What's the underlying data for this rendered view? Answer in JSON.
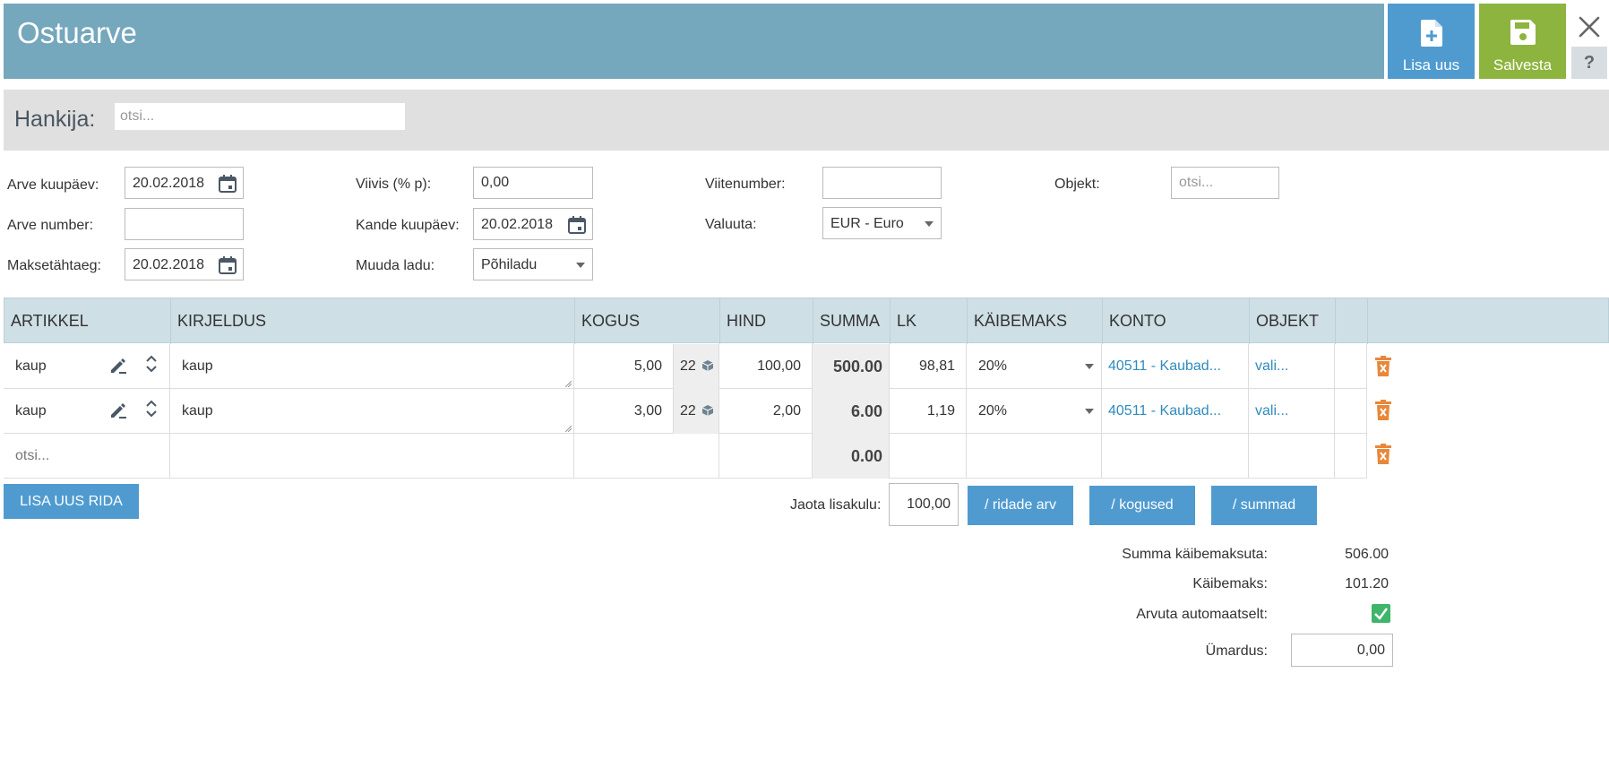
{
  "header": {
    "title": "Ostuarve",
    "add_new_label": "Lisa uus",
    "save_label": "Salvesta",
    "help_label": "?"
  },
  "supplier": {
    "label": "Hankija:",
    "placeholder": "otsi..."
  },
  "form": {
    "invoice_date_label": "Arve kuupäev:",
    "invoice_date": "20.02.2018",
    "invoice_number_label": "Arve number:",
    "invoice_number": "",
    "due_date_label": "Maksetähtaeg:",
    "due_date": "20.02.2018",
    "penalty_label": "Viivis (% p):",
    "penalty": "0,00",
    "entry_date_label": "Kande kuupäev:",
    "entry_date": "20.02.2018",
    "warehouse_label": "Muuda ladu:",
    "warehouse": "Põhiladu",
    "reference_label": "Viitenumber:",
    "reference": "",
    "currency_label": "Valuuta:",
    "currency": "EUR - Euro",
    "object_label": "Objekt:",
    "object_placeholder": "otsi..."
  },
  "table": {
    "columns": [
      "ARTIKKEL",
      "KIRJELDUS",
      "KOGUS",
      "HIND",
      "SUMMA",
      "LK",
      "KÄIBEMAKS",
      "KONTO",
      "OBJEKT"
    ],
    "rows": [
      {
        "article": "kaup",
        "description": "kaup",
        "quantity": "5,00",
        "stock": "22",
        "price": "100,00",
        "sum": "500.00",
        "lk": "98,81",
        "vat": "20%",
        "account": "40511 - Kaubad...",
        "object": "vali..."
      },
      {
        "article": "kaup",
        "description": "kaup",
        "quantity": "3,00",
        "stock": "22",
        "price": "2,00",
        "sum": "6.00",
        "lk": "1,19",
        "vat": "20%",
        "account": "40511 - Kaubad...",
        "object": "vali..."
      }
    ],
    "new_row": {
      "article_placeholder": "otsi...",
      "sum": "0.00"
    }
  },
  "actions": {
    "add_row_label": "LISA UUS RIDA",
    "distribute_label": "Jaota lisakulu:",
    "distribute_value": "100,00",
    "by_rows_label": "/ ridade arv",
    "by_quantities_label": "/ kogused",
    "by_sums_label": "/ summad"
  },
  "totals": {
    "net_label": "Summa käibemaksuta:",
    "net_value": "506.00",
    "vat_label": "Käibemaks:",
    "vat_value": "101.20",
    "auto_label": "Arvuta automaatselt:",
    "auto_checked": true,
    "rounding_label": "Ümardus:",
    "rounding_value": "0,00"
  },
  "colors": {
    "header": "#75a7bd",
    "primary_button": "#4f9bd0",
    "save_button": "#8db43e",
    "delete_icon": "#e8873a",
    "link": "#2f8bbd",
    "checkbox": "#3fb56b"
  }
}
